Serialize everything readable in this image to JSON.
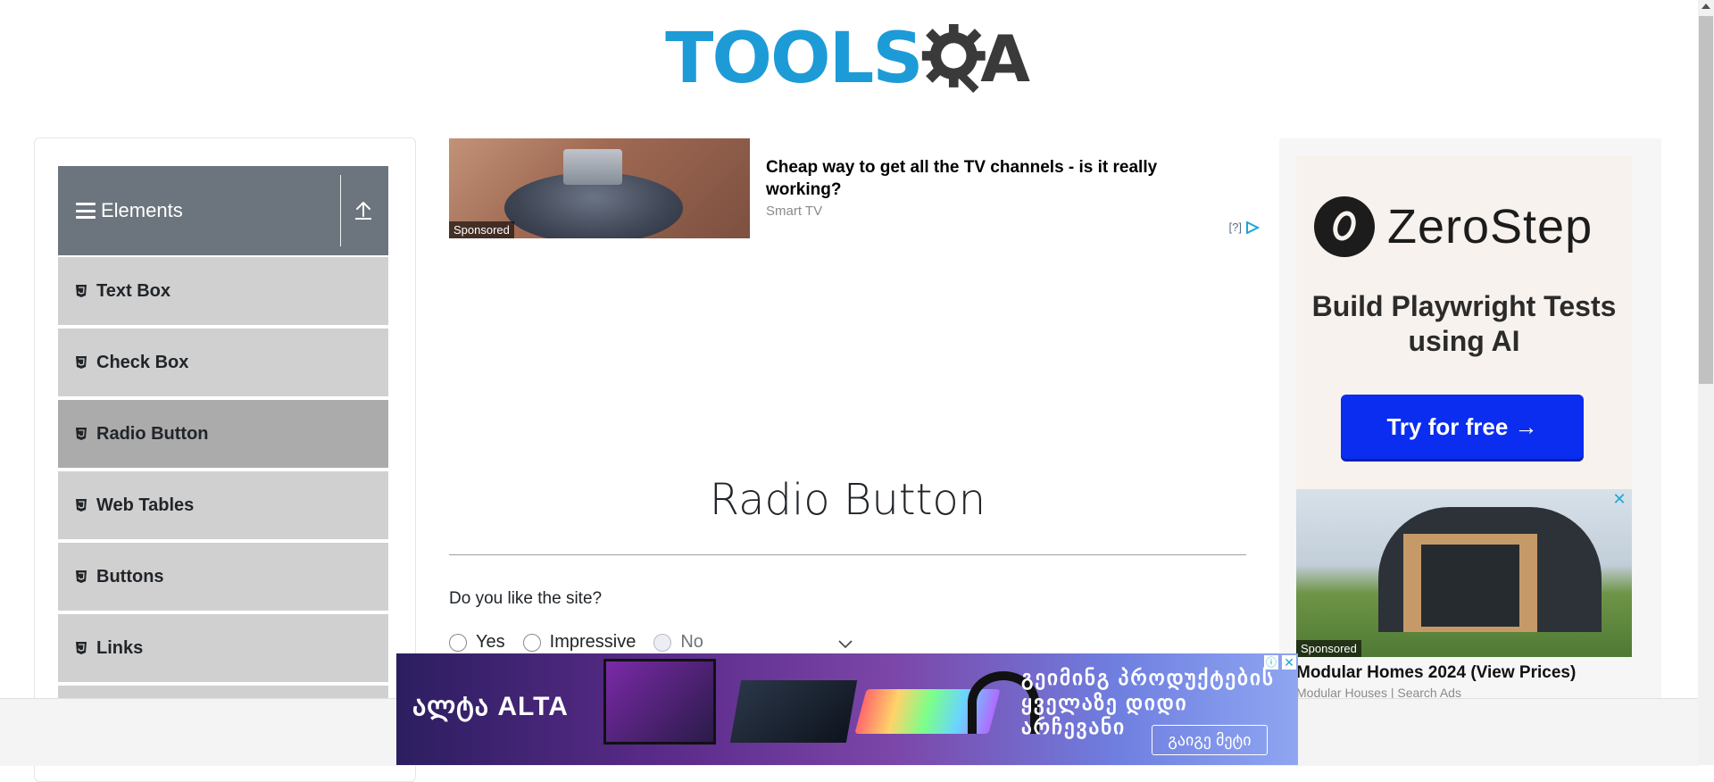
{
  "header": {
    "logo_text": "TOOLS",
    "logo_suffix": "A"
  },
  "sidebar": {
    "group_title": "Elements",
    "items": [
      {
        "label": "Text Box"
      },
      {
        "label": "Check Box"
      },
      {
        "label": "Radio Button",
        "active": true
      },
      {
        "label": "Web Tables"
      },
      {
        "label": "Buttons"
      },
      {
        "label": "Links"
      }
    ]
  },
  "ad_top": {
    "title": "Cheap way to get all the TV channels - is it really working?",
    "source": "Smart TV",
    "sponsored": "Sponsored",
    "info": "[?]"
  },
  "main": {
    "page_title": "Radio Button",
    "question": "Do you like the site?",
    "options": [
      {
        "label": "Yes",
        "disabled": false
      },
      {
        "label": "Impressive",
        "disabled": false
      },
      {
        "label": "No",
        "disabled": true
      }
    ]
  },
  "right_ad": {
    "brand": "ZeroStep",
    "headline": "Build Playwright Tests using AI",
    "cta": "Try for free →",
    "sponsored": "Sponsored",
    "house_title": "Modular Homes 2024 (View Prices)",
    "house_source": "Modular Houses | Search Ads",
    "close": "✕"
  },
  "bottom_ad": {
    "brand": "ალტა ALTA",
    "line1": "გეიმინგ პროდუქტების",
    "line2": "ყველაზე დიდი არჩევანი",
    "cta": "გაიგე მეტი",
    "info": "ⓘ",
    "close": "✕"
  },
  "colors": {
    "brand_blue": "#1d9bd7",
    "sidebar_header": "#6c757d",
    "menu_item": "#d0d0d0",
    "menu_item_active": "#ababab",
    "zerostep_cta": "#0b2df0"
  }
}
